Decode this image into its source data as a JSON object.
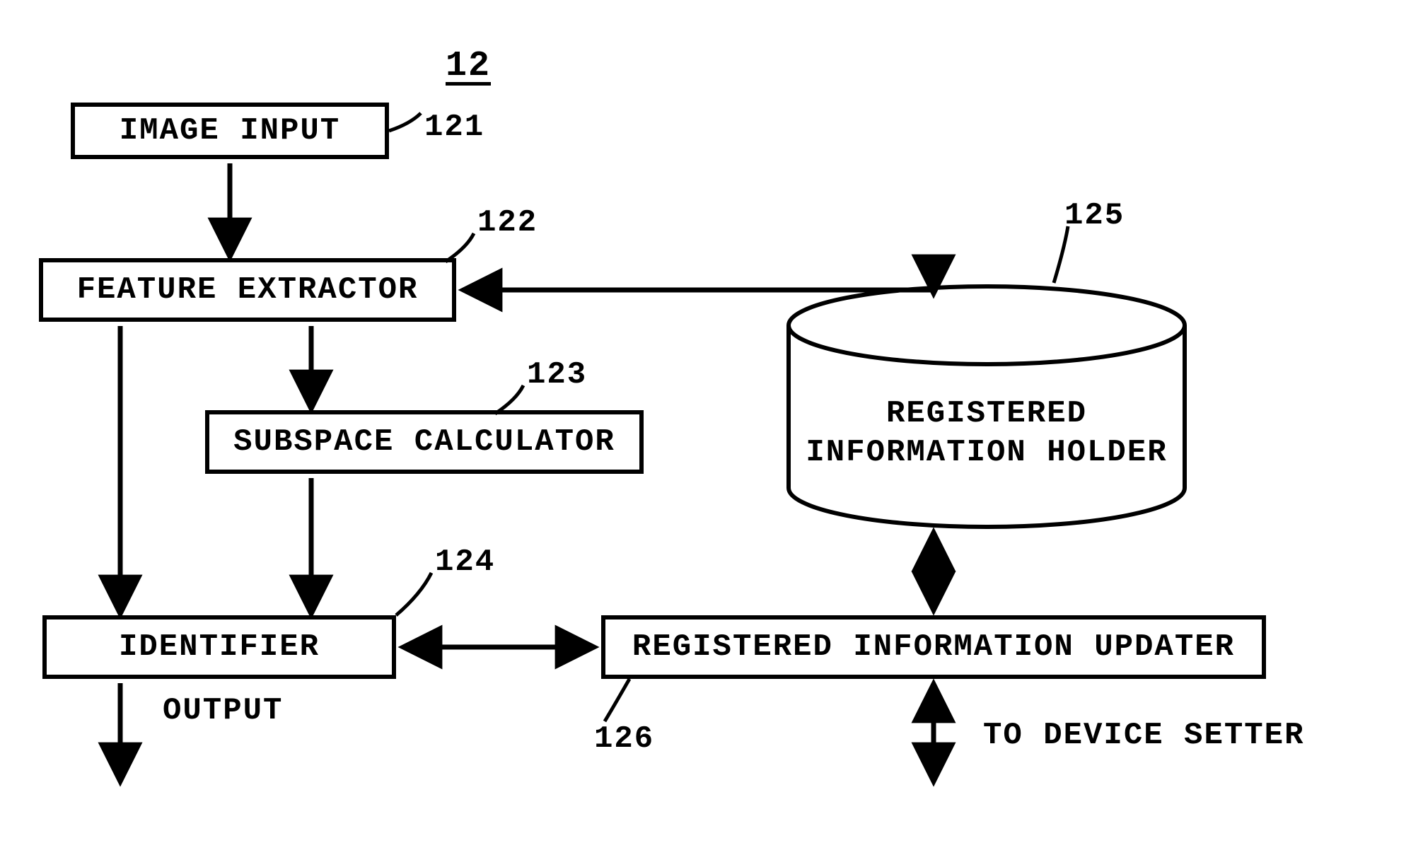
{
  "title": "12",
  "boxes": {
    "image_input": {
      "label": "IMAGE INPUT",
      "ref": "121"
    },
    "feature_extractor": {
      "label": "FEATURE EXTRACTOR",
      "ref": "122"
    },
    "subspace_calculator": {
      "label": "SUBSPACE CALCULATOR",
      "ref": "123"
    },
    "identifier": {
      "label": "IDENTIFIER",
      "ref": "124"
    },
    "db": {
      "line1": "REGISTERED",
      "line2": "INFORMATION HOLDER",
      "ref": "125"
    },
    "updater": {
      "label": "REGISTERED INFORMATION UPDATER",
      "ref": "126"
    }
  },
  "free_labels": {
    "output": "OUTPUT",
    "to_device_setter": "TO DEVICE SETTER"
  }
}
